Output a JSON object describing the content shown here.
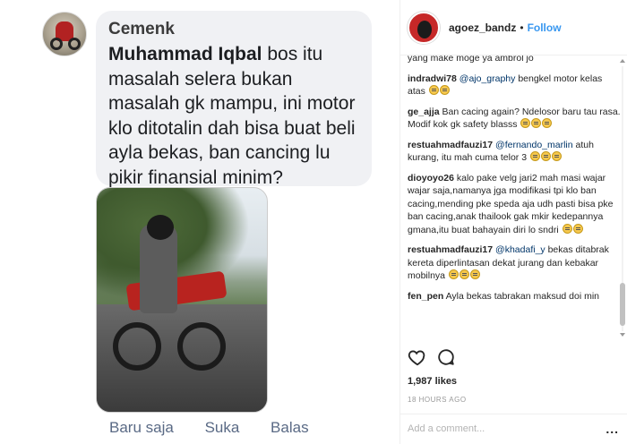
{
  "fb": {
    "author": "Cemenk",
    "mention": "Muhammad Iqbal",
    "comment": " bos itu masalah selera bukan masalah gk mampu, ini motor klo ditotalin dah bisa buat beli ayla bekas, ban cancing lu pikir finansial minim?",
    "actions": [
      "Baru saja",
      "Suka",
      "Balas"
    ]
  },
  "ig": {
    "username": "agoez_bandz",
    "separator": "•",
    "follow": "Follow",
    "prev_text": "yang make moge ya ambrol jo",
    "comments": [
      {
        "user": "indradwi78",
        "mention": "@ajo_graphy",
        "text": " bengkel motor kelas atas",
        "emojis": 2
      },
      {
        "user": "ge_ajja",
        "mention": "",
        "text": "Ban cacing again? Ndelosor baru tau rasa. Modif kok gk safety blasss",
        "emojis": 3
      },
      {
        "user": "restuahmadfauzi17",
        "mention": "@fernando_marlin",
        "text": " atuh kurang, itu mah cuma telor 3",
        "emojis": 3
      },
      {
        "user": "dioyoyo26",
        "mention": "",
        "text": "kalo pake velg jari2 mah masi wajar wajar saja,namanya jga modifikasi tpi klo ban cacing,mending pke speda aja udh pasti bisa pke ban cacing,anak thailook gak mkir kedepannya gmana,itu buat bahayain diri lo sndri",
        "emojis": 2
      },
      {
        "user": "restuahmadfauzi17",
        "mention": "@khadafi_y",
        "text": " bekas ditabrak kereta diperlintasan dekat jurang dan kebakar mobilnya",
        "emojis": 3
      },
      {
        "user": "fen_pen",
        "mention": "",
        "text": "Ayla bekas tabrakan maksud doi min",
        "emojis": 0
      }
    ],
    "likes": "1,987 likes",
    "time": "18 HOURS AGO",
    "add_comment_placeholder": "Add a comment...",
    "more": "..."
  }
}
